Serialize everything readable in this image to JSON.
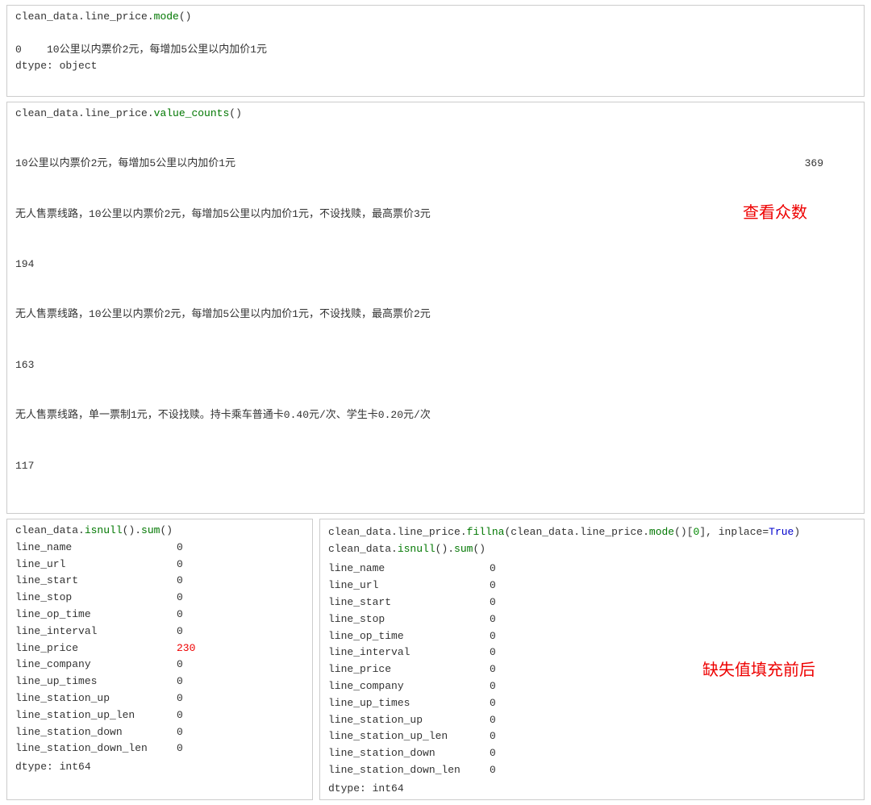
{
  "top": {
    "cell1": {
      "code": "clean_data.line_price.mode()",
      "output_lines": [
        "0    10公里以内票价2元，每增加5公里以内加价1元",
        "dtype: object"
      ]
    },
    "cell2": {
      "code": "clean_data.line_price.value_counts()",
      "rows": [
        {
          "label": "10公里以内票价2元，每增加5公里以内加价1元",
          "value": "369"
        },
        {
          "label": "无人售票线路，10公里以内票价2元，每增加5公里以内加价1元，不设找赎，最高票价3元",
          "value": ""
        },
        {
          "label": "194",
          "value": ""
        },
        {
          "label": "无人售票线路，10公里以内票价2元，每增加5公里以内加价1元，不设找赎，最高票价2元",
          "value": ""
        },
        {
          "label": "163",
          "value": ""
        },
        {
          "label": "无人售票线路，单一票制1元，不设找赎。持卡乘车普通卡0.40元/次、学生卡0.20元/次",
          "value": ""
        },
        {
          "label": "117",
          "value": ""
        }
      ],
      "annotation": "查看众数"
    }
  },
  "bottom": {
    "left": {
      "code": "clean_data.isnull().sum()",
      "fields": [
        {
          "name": "line_name",
          "value": "0"
        },
        {
          "name": "line_url",
          "value": "0"
        },
        {
          "name": "line_start",
          "value": "0"
        },
        {
          "name": "line_stop",
          "value": "0"
        },
        {
          "name": "line_op_time",
          "value": "0"
        },
        {
          "name": "line_interval",
          "value": "0"
        },
        {
          "name": "line_price",
          "value": "230",
          "highlight": true
        },
        {
          "name": "line_company",
          "value": "0"
        },
        {
          "name": "line_up_times",
          "value": "0"
        },
        {
          "name": "line_station_up",
          "value": "0"
        },
        {
          "name": "line_station_up_len",
          "value": "0"
        },
        {
          "name": "line_station_down",
          "value": "0"
        },
        {
          "name": "line_station_down_len",
          "value": "0"
        }
      ],
      "dtype": "dtype: int64"
    },
    "right": {
      "code_line1": "clean_data.line_price.fillna(clean_data.line_price.mode()[0], inplace=True)",
      "code_line2": "clean_data.isnull().sum()",
      "fields": [
        {
          "name": "line_name",
          "value": "0"
        },
        {
          "name": "line_url",
          "value": "0"
        },
        {
          "name": "line_start",
          "value": "0"
        },
        {
          "name": "line_stop",
          "value": "0"
        },
        {
          "name": "line_op_time",
          "value": "0"
        },
        {
          "name": "line_interval",
          "value": "0"
        },
        {
          "name": "line_price",
          "value": "0"
        },
        {
          "name": "line_company",
          "value": "0"
        },
        {
          "name": "line_up_times",
          "value": "0"
        },
        {
          "name": "line_station_up",
          "value": "0"
        },
        {
          "name": "line_station_up_len",
          "value": "0"
        },
        {
          "name": "line_station_down",
          "value": "0"
        },
        {
          "name": "line_station_down_len",
          "value": "0"
        }
      ],
      "dtype": "dtype: int64",
      "annotation": "缺失值填充前后"
    }
  }
}
